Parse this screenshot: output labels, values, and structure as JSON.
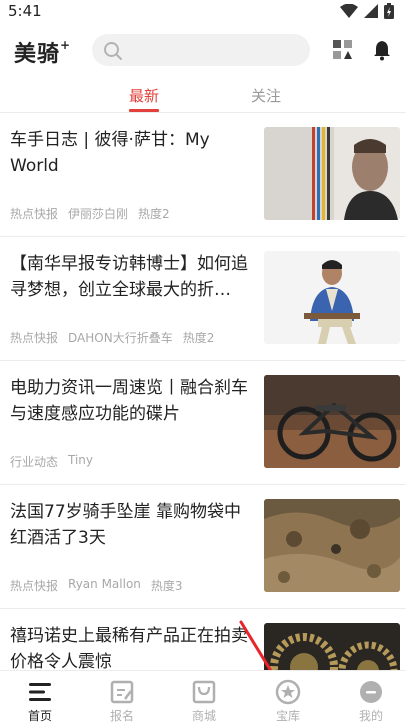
{
  "status_bar": {
    "time": "5:41"
  },
  "header": {
    "logo": "美骑",
    "logo_mark": "+"
  },
  "tabs": [
    {
      "label": "最新",
      "active": true
    },
    {
      "label": "关注",
      "active": false
    }
  ],
  "articles": [
    {
      "title": "车手日志 | 彼得·萨甘：My World",
      "category": "热点快报",
      "author": "伊丽莎白刚",
      "heat": "热度2",
      "thumb": "photo-rider-portrait"
    },
    {
      "title": "【南华早报专访韩博士】如何追寻梦想，创立全球最大的折…",
      "category": "热点快报",
      "author": "DAHON大行折叠车",
      "heat": "热度2",
      "thumb": "photo-man-in-suit"
    },
    {
      "title": "电助力资讯一周速览丨融合刹车与速度感应功能的碟片",
      "category": "行业动态",
      "author": "Tiny",
      "heat": "",
      "thumb": "photo-ebike-dirt"
    },
    {
      "title": "法国77岁骑手坠崖 靠购物袋中红酒活了3天",
      "category": "热点快报",
      "author": "Ryan Mallon",
      "heat": "热度3",
      "thumb": "photo-rocky-terrain"
    },
    {
      "title": "禧玛诺史上最稀有产品正在拍卖 价格令人震惊",
      "category": "",
      "author": "",
      "heat": "",
      "thumb": "photo-gears"
    }
  ],
  "tabbar": [
    {
      "label": "首页",
      "icon": "home-icon",
      "active": true
    },
    {
      "label": "报名",
      "icon": "signup-icon",
      "active": false
    },
    {
      "label": "商城",
      "icon": "shop-icon",
      "active": false
    },
    {
      "label": "宝库",
      "icon": "treasury-icon",
      "active": false
    },
    {
      "label": "我的",
      "icon": "profile-icon",
      "active": false
    }
  ],
  "colors": {
    "accent": "#e2413b",
    "annotation": "#e8242a"
  }
}
